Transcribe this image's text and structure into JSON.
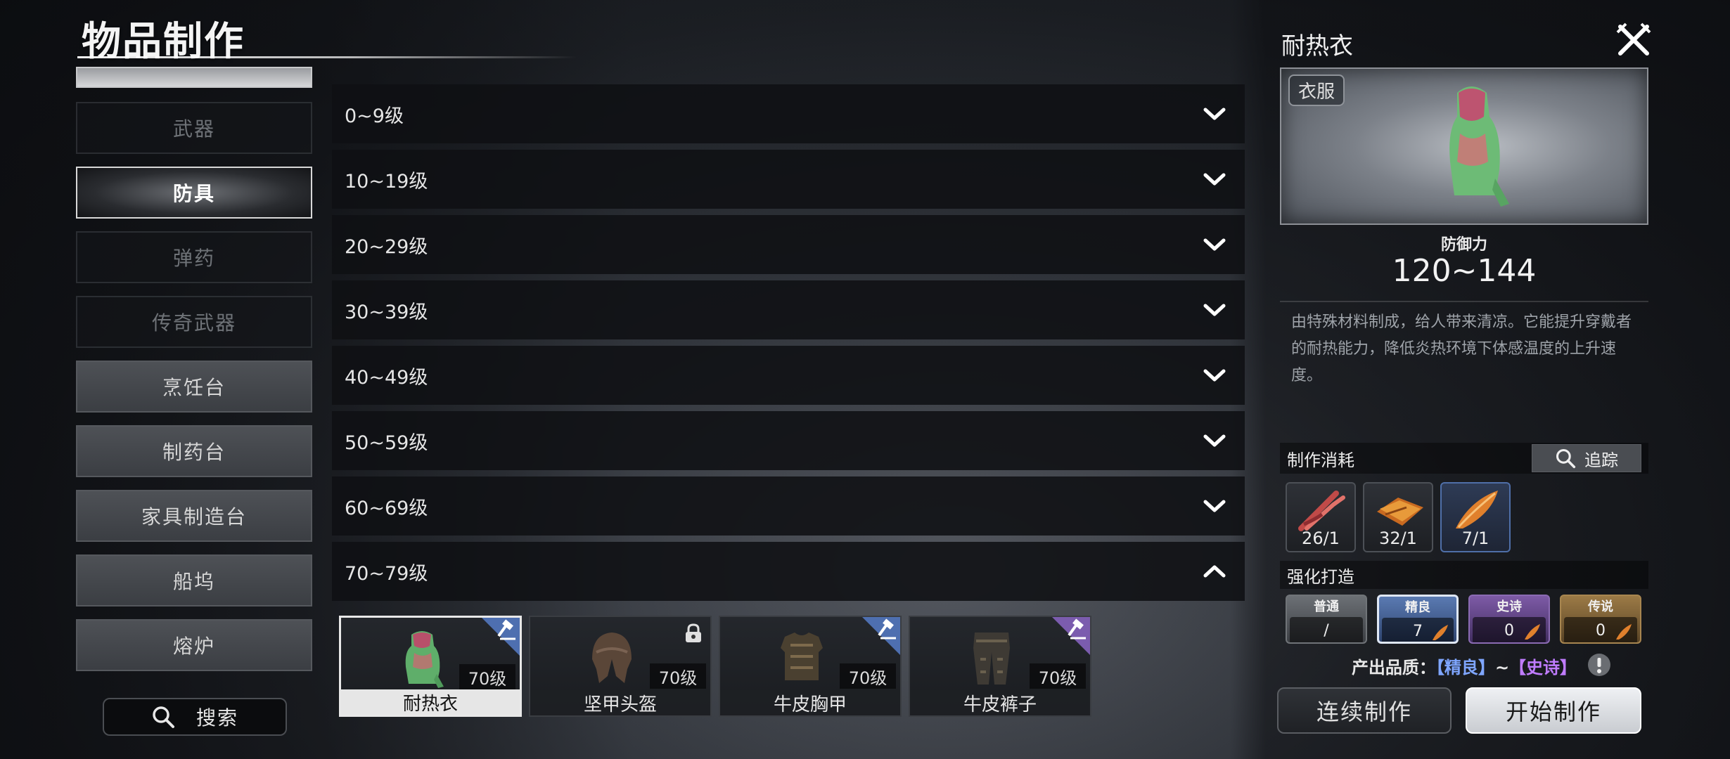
{
  "header": {
    "title": "物品制作"
  },
  "categories": [
    {
      "label": "",
      "state": "light"
    },
    {
      "label": "武器",
      "state": "dim"
    },
    {
      "label": "防具",
      "state": "active"
    },
    {
      "label": "弹药",
      "state": "dim"
    },
    {
      "label": "传奇武器",
      "state": "dim"
    },
    {
      "label": "烹饪台",
      "state": "light"
    },
    {
      "label": "制药台",
      "state": "light"
    },
    {
      "label": "家具制造台",
      "state": "light"
    },
    {
      "label": "船坞",
      "state": "light"
    },
    {
      "label": "熔炉",
      "state": "light"
    }
  ],
  "search": {
    "label": "搜索",
    "icon": "search-icon"
  },
  "levels": [
    {
      "label": "0~9级",
      "expanded": false
    },
    {
      "label": "10~19级",
      "expanded": false
    },
    {
      "label": "20~29级",
      "expanded": false
    },
    {
      "label": "30~39级",
      "expanded": false
    },
    {
      "label": "40~49级",
      "expanded": false
    },
    {
      "label": "50~59级",
      "expanded": false
    },
    {
      "label": "60~69级",
      "expanded": false
    },
    {
      "label": "70~79级",
      "expanded": true
    }
  ],
  "items": [
    {
      "name": "耐热衣",
      "level": "70级",
      "badge": "blue-hammer",
      "selected": true
    },
    {
      "name": "坚甲头盔",
      "level": "70级",
      "badge": "lock",
      "selected": false
    },
    {
      "name": "牛皮胸甲",
      "level": "70级",
      "badge": "blue-hammer",
      "selected": false
    },
    {
      "name": "牛皮裤子",
      "level": "70级",
      "badge": "purple-hammer",
      "selected": false
    }
  ],
  "detail": {
    "title": "耐热衣",
    "tag": "衣服",
    "stat_label": "防御力",
    "stat_value": "120~144",
    "description": "由特殊材料制成，给人带来清凉。它能提升穿戴者的耐热能力，降低炎热环境下体感温度的上升速度。",
    "cost_label": "制作消耗",
    "track_label": "追踪",
    "materials": [
      {
        "count": "26/1",
        "rarity": "common"
      },
      {
        "count": "32/1",
        "rarity": "common"
      },
      {
        "count": "7/1",
        "rarity": "fine"
      }
    ],
    "forge_label": "强化打造",
    "tiers": [
      {
        "name": "普通",
        "value": "/",
        "class": "common"
      },
      {
        "name": "精良",
        "value": "7",
        "class": "fine"
      },
      {
        "name": "史诗",
        "value": "0",
        "class": "epic"
      },
      {
        "name": "传说",
        "value": "0",
        "class": "legend"
      }
    ],
    "quality_prefix": "产出品质：",
    "quality_low": "【精良】",
    "quality_sep": "~",
    "quality_high": "【史诗】",
    "btn_continue": "连续制作",
    "btn_start": "开始制作"
  },
  "colors": {
    "fine": "#5a7ab2",
    "epic": "#7d5aa6",
    "legend": "#9c7a46",
    "accent_blue": "#7fa6ff",
    "accent_purple": "#c07cff"
  }
}
